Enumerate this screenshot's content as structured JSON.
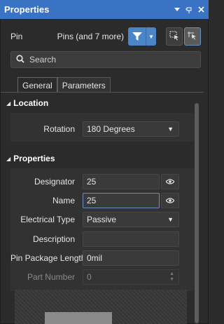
{
  "window": {
    "title": "Properties",
    "controls": [
      "dropdown-icon",
      "pin-icon",
      "close-icon"
    ]
  },
  "header": {
    "object_kind": "Pin",
    "selection_summary": "Pins (and 7 more)",
    "filter_icon": "filter-icon",
    "select_icons": [
      "select-objects-icon",
      "select-under-cursor-icon"
    ]
  },
  "search": {
    "placeholder": "Search"
  },
  "tabs": [
    {
      "label": "General",
      "active": true
    },
    {
      "label": "Parameters",
      "active": false
    }
  ],
  "sections": {
    "location": {
      "title": "Location",
      "rotation_label": "Rotation",
      "rotation_value": "180 Degrees"
    },
    "properties": {
      "title": "Properties",
      "designator_label": "Designator",
      "designator_value": "25",
      "name_label": "Name",
      "name_value": "25",
      "electrical_type_label": "Electrical Type",
      "electrical_type_value": "Passive",
      "description_label": "Description",
      "description_value": "",
      "pin_package_length_label": "Pin Package Length",
      "pin_package_length_value": "0mil",
      "part_number_label": "Part Number",
      "part_number_value": "0"
    }
  },
  "colors": {
    "title_bar": "#3a72c4",
    "accent": "#4a84c9",
    "panel_bg": "#2b2b2b"
  }
}
